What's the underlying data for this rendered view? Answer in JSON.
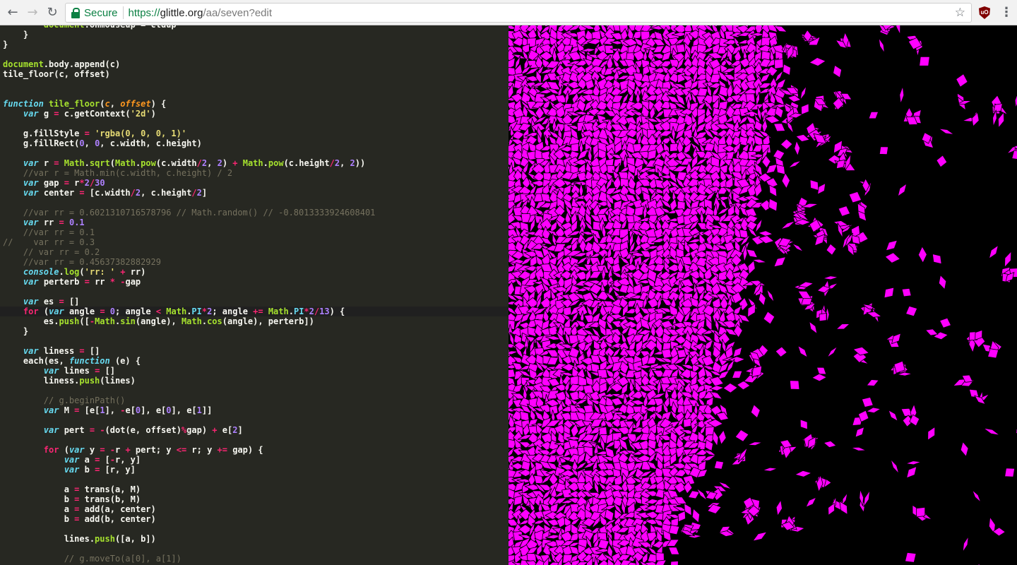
{
  "browser": {
    "secure_label": "Secure",
    "url_scheme": "https://",
    "url_host": "glittle.org",
    "url_path": "/aa/seven?edit",
    "back_icon": "arrow-left-icon",
    "forward_icon": "arrow-right-icon",
    "reload_icon": "reload-icon",
    "lock_icon": "lock-icon",
    "star_icon": "star-icon",
    "extension_icon": "ublock-origin-icon",
    "menu_icon": "vertical-dots-icon",
    "extension_label": "uO"
  },
  "editor": {
    "theme": "monokai",
    "active_line": 30,
    "lines": [
      [
        [
          "pl",
          "        "
        ],
        [
          "fn",
          "document"
        ],
        [
          "pl",
          ".onmouseup = ctdup"
        ]
      ],
      [
        [
          "pl",
          "    }"
        ]
      ],
      [
        [
          "pl",
          "}"
        ]
      ],
      [],
      [
        [
          "fn",
          "document"
        ],
        [
          "pl",
          ".body.append(c)"
        ]
      ],
      [
        [
          "pl",
          "tile_floor(c, offset)"
        ]
      ],
      [],
      [],
      [
        [
          "st",
          "function"
        ],
        [
          "pl",
          " "
        ],
        [
          "fn",
          "tile_floor"
        ],
        [
          "pl",
          "("
        ],
        [
          "pa",
          "c"
        ],
        [
          "pl",
          ", "
        ],
        [
          "pa",
          "offset"
        ],
        [
          "pl",
          ") {"
        ]
      ],
      [
        [
          "pl",
          "    "
        ],
        [
          "st",
          "var"
        ],
        [
          "pl",
          " g "
        ],
        [
          "kw",
          "="
        ],
        [
          "pl",
          " c.getContext("
        ],
        [
          "sr",
          "'2d'"
        ],
        [
          "pl",
          ")"
        ]
      ],
      [],
      [
        [
          "pl",
          "    g.fillStyle "
        ],
        [
          "kw",
          "="
        ],
        [
          "pl",
          " "
        ],
        [
          "sr",
          "'rgba(0, 0, 0, 1)'"
        ]
      ],
      [
        [
          "pl",
          "    g.fillRect("
        ],
        [
          "nu",
          "0"
        ],
        [
          "pl",
          ", "
        ],
        [
          "nu",
          "0"
        ],
        [
          "pl",
          ", c.width, c.height)"
        ]
      ],
      [],
      [
        [
          "pl",
          "    "
        ],
        [
          "st",
          "var"
        ],
        [
          "pl",
          " r "
        ],
        [
          "kw",
          "="
        ],
        [
          "pl",
          " "
        ],
        [
          "fn",
          "Math"
        ],
        [
          "pl",
          "."
        ],
        [
          "fn",
          "sqrt"
        ],
        [
          "pl",
          "("
        ],
        [
          "fn",
          "Math"
        ],
        [
          "pl",
          "."
        ],
        [
          "fn",
          "pow"
        ],
        [
          "pl",
          "(c.width"
        ],
        [
          "kw",
          "/"
        ],
        [
          "nu",
          "2"
        ],
        [
          "pl",
          ", "
        ],
        [
          "nu",
          "2"
        ],
        [
          "pl",
          ") "
        ],
        [
          "kw",
          "+"
        ],
        [
          "pl",
          " "
        ],
        [
          "fn",
          "Math"
        ],
        [
          "pl",
          "."
        ],
        [
          "fn",
          "pow"
        ],
        [
          "pl",
          "(c.height"
        ],
        [
          "kw",
          "/"
        ],
        [
          "nu",
          "2"
        ],
        [
          "pl",
          ", "
        ],
        [
          "nu",
          "2"
        ],
        [
          "pl",
          "))"
        ]
      ],
      [
        [
          "cm",
          "    //var r = Math.min(c.width, c.height) / 2"
        ]
      ],
      [
        [
          "pl",
          "    "
        ],
        [
          "st",
          "var"
        ],
        [
          "pl",
          " gap "
        ],
        [
          "kw",
          "="
        ],
        [
          "pl",
          " r"
        ],
        [
          "kw",
          "*"
        ],
        [
          "nu",
          "2"
        ],
        [
          "kw",
          "/"
        ],
        [
          "nu",
          "30"
        ]
      ],
      [
        [
          "pl",
          "    "
        ],
        [
          "st",
          "var"
        ],
        [
          "pl",
          " center "
        ],
        [
          "kw",
          "="
        ],
        [
          "pl",
          " [c.width"
        ],
        [
          "kw",
          "/"
        ],
        [
          "nu",
          "2"
        ],
        [
          "pl",
          ", c.height"
        ],
        [
          "kw",
          "/"
        ],
        [
          "nu",
          "2"
        ],
        [
          "pl",
          "]"
        ]
      ],
      [],
      [
        [
          "cm",
          "    //var rr = 0.6021310716578796 // Math.random() // -0.8013333924608401"
        ]
      ],
      [
        [
          "pl",
          "    "
        ],
        [
          "st",
          "var"
        ],
        [
          "pl",
          " rr "
        ],
        [
          "kw",
          "="
        ],
        [
          "pl",
          " "
        ],
        [
          "nu",
          "0.1"
        ]
      ],
      [
        [
          "cm",
          "    //var rr = 0.1"
        ]
      ],
      [
        [
          "cm",
          "//    var rr = 0.3"
        ]
      ],
      [
        [
          "cm",
          "    // var rr = 0.2"
        ]
      ],
      [
        [
          "cm",
          "    //var rr = 0.45637382882929"
        ]
      ],
      [
        [
          "pl",
          "    "
        ],
        [
          "st",
          "console"
        ],
        [
          "pl",
          "."
        ],
        [
          "fn",
          "log"
        ],
        [
          "pl",
          "("
        ],
        [
          "sr",
          "'rr: '"
        ],
        [
          "pl",
          " "
        ],
        [
          "kw",
          "+"
        ],
        [
          "pl",
          " rr)"
        ]
      ],
      [
        [
          "pl",
          "    "
        ],
        [
          "st",
          "var"
        ],
        [
          "pl",
          " perterb "
        ],
        [
          "kw",
          "="
        ],
        [
          "pl",
          " rr "
        ],
        [
          "kw",
          "*"
        ],
        [
          "pl",
          " "
        ],
        [
          "kw",
          "-"
        ],
        [
          "pl",
          "gap"
        ]
      ],
      [],
      [
        [
          "pl",
          "    "
        ],
        [
          "st",
          "var"
        ],
        [
          "pl",
          " es "
        ],
        [
          "kw",
          "="
        ],
        [
          "pl",
          " []"
        ]
      ],
      [
        [
          "pl",
          "    "
        ],
        [
          "kw",
          "for"
        ],
        [
          "pl",
          " ("
        ],
        [
          "st",
          "var"
        ],
        [
          "pl",
          " angle "
        ],
        [
          "kw",
          "="
        ],
        [
          "pl",
          " "
        ],
        [
          "nu",
          "0"
        ],
        [
          "pl",
          "; angle "
        ],
        [
          "kw",
          "<"
        ],
        [
          "pl",
          " "
        ],
        [
          "fn",
          "Math"
        ],
        [
          "pl",
          "."
        ],
        [
          "sp",
          "PI"
        ],
        [
          "kw",
          "*"
        ],
        [
          "nu",
          "2"
        ],
        [
          "pl",
          "; angle "
        ],
        [
          "kw",
          "+="
        ],
        [
          "pl",
          " "
        ],
        [
          "fn",
          "Math"
        ],
        [
          "pl",
          "."
        ],
        [
          "sp",
          "PI"
        ],
        [
          "kw",
          "*"
        ],
        [
          "nu",
          "2"
        ],
        [
          "kw",
          "/"
        ],
        [
          "nu",
          "13"
        ],
        [
          "pl",
          ") {"
        ]
      ],
      [
        [
          "pl",
          "        es."
        ],
        [
          "fn",
          "push"
        ],
        [
          "pl",
          "(["
        ],
        [
          "kw",
          "-"
        ],
        [
          "fn",
          "Math"
        ],
        [
          "pl",
          "."
        ],
        [
          "fn",
          "sin"
        ],
        [
          "pl",
          "(angle), "
        ],
        [
          "fn",
          "Math"
        ],
        [
          "pl",
          "."
        ],
        [
          "fn",
          "cos"
        ],
        [
          "pl",
          "(angle), perterb])"
        ]
      ],
      [
        [
          "pl",
          "    }"
        ]
      ],
      [],
      [
        [
          "pl",
          "    "
        ],
        [
          "st",
          "var"
        ],
        [
          "pl",
          " liness "
        ],
        [
          "kw",
          "="
        ],
        [
          "pl",
          " []"
        ]
      ],
      [
        [
          "pl",
          "    each(es, "
        ],
        [
          "st",
          "function"
        ],
        [
          "pl",
          " (e) {"
        ]
      ],
      [
        [
          "pl",
          "        "
        ],
        [
          "st",
          "var"
        ],
        [
          "pl",
          " lines "
        ],
        [
          "kw",
          "="
        ],
        [
          "pl",
          " []"
        ]
      ],
      [
        [
          "pl",
          "        liness."
        ],
        [
          "fn",
          "push"
        ],
        [
          "pl",
          "(lines)"
        ]
      ],
      [],
      [
        [
          "cm",
          "        // g.beginPath()"
        ]
      ],
      [
        [
          "pl",
          "        "
        ],
        [
          "st",
          "var"
        ],
        [
          "pl",
          " M "
        ],
        [
          "kw",
          "="
        ],
        [
          "pl",
          " [e["
        ],
        [
          "nu",
          "1"
        ],
        [
          "pl",
          "], "
        ],
        [
          "kw",
          "-"
        ],
        [
          "pl",
          "e["
        ],
        [
          "nu",
          "0"
        ],
        [
          "pl",
          "], e["
        ],
        [
          "nu",
          "0"
        ],
        [
          "pl",
          "], e["
        ],
        [
          "nu",
          "1"
        ],
        [
          "pl",
          "]]"
        ]
      ],
      [],
      [
        [
          "pl",
          "        "
        ],
        [
          "st",
          "var"
        ],
        [
          "pl",
          " pert "
        ],
        [
          "kw",
          "="
        ],
        [
          "pl",
          " "
        ],
        [
          "kw",
          "-"
        ],
        [
          "pl",
          "(dot(e, offset)"
        ],
        [
          "kw",
          "%"
        ],
        [
          "pl",
          "gap) "
        ],
        [
          "kw",
          "+"
        ],
        [
          "pl",
          " e["
        ],
        [
          "nu",
          "2"
        ],
        [
          "pl",
          "]"
        ]
      ],
      [],
      [
        [
          "pl",
          "        "
        ],
        [
          "kw",
          "for"
        ],
        [
          "pl",
          " ("
        ],
        [
          "st",
          "var"
        ],
        [
          "pl",
          " y "
        ],
        [
          "kw",
          "="
        ],
        [
          "pl",
          " "
        ],
        [
          "kw",
          "-"
        ],
        [
          "pl",
          "r "
        ],
        [
          "kw",
          "+"
        ],
        [
          "pl",
          " pert; y "
        ],
        [
          "kw",
          "<="
        ],
        [
          "pl",
          " r; y "
        ],
        [
          "kw",
          "+="
        ],
        [
          "pl",
          " gap) {"
        ]
      ],
      [
        [
          "pl",
          "            "
        ],
        [
          "st",
          "var"
        ],
        [
          "pl",
          " a "
        ],
        [
          "kw",
          "="
        ],
        [
          "pl",
          " ["
        ],
        [
          "kw",
          "-"
        ],
        [
          "pl",
          "r, y]"
        ]
      ],
      [
        [
          "pl",
          "            "
        ],
        [
          "st",
          "var"
        ],
        [
          "pl",
          " b "
        ],
        [
          "kw",
          "="
        ],
        [
          "pl",
          " [r, y]"
        ]
      ],
      [],
      [
        [
          "pl",
          "            a "
        ],
        [
          "kw",
          "="
        ],
        [
          "pl",
          " trans(a, M)"
        ]
      ],
      [
        [
          "pl",
          "            b "
        ],
        [
          "kw",
          "="
        ],
        [
          "pl",
          " trans(b, M)"
        ]
      ],
      [
        [
          "pl",
          "            a "
        ],
        [
          "kw",
          "="
        ],
        [
          "pl",
          " add(a, center)"
        ]
      ],
      [
        [
          "pl",
          "            b "
        ],
        [
          "kw",
          "="
        ],
        [
          "pl",
          " add(b, center)"
        ]
      ],
      [],
      [
        [
          "pl",
          "            lines."
        ],
        [
          "fn",
          "push"
        ],
        [
          "pl",
          "([a, b])"
        ]
      ],
      [],
      [
        [
          "cm",
          "            // g.moveTo(a[0], a[1])"
        ]
      ]
    ]
  },
  "canvas": {
    "background": "#000000",
    "tile_fill": "#ff00ff",
    "tile_stroke": "#000000"
  }
}
